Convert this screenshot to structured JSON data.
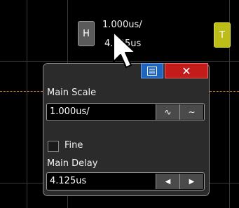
{
  "horizontal": {
    "button_label": "H",
    "scale_readout": "1.000us/",
    "delay_readout": "4.125us"
  },
  "trigger": {
    "button_label": "T"
  },
  "panel": {
    "menu_icon": "menu-list-icon",
    "close_label": "✕",
    "main_scale": {
      "label": "Main Scale",
      "value": "1.000us/",
      "fine_icon": "∿",
      "coarse_icon": "∼"
    },
    "fine": {
      "label": "Fine",
      "checked": false
    },
    "main_delay": {
      "label": "Main Delay",
      "value": "4.125us",
      "left_arrow": "◀",
      "right_arrow": "▶"
    }
  },
  "colors": {
    "background": "#000000",
    "panel": "#2b2b2b",
    "menu_button": "#1f64bd",
    "close_button": "#c41b1b",
    "trigger_button": "#bdbd1a",
    "trigger_level_line": "#d0782a"
  }
}
